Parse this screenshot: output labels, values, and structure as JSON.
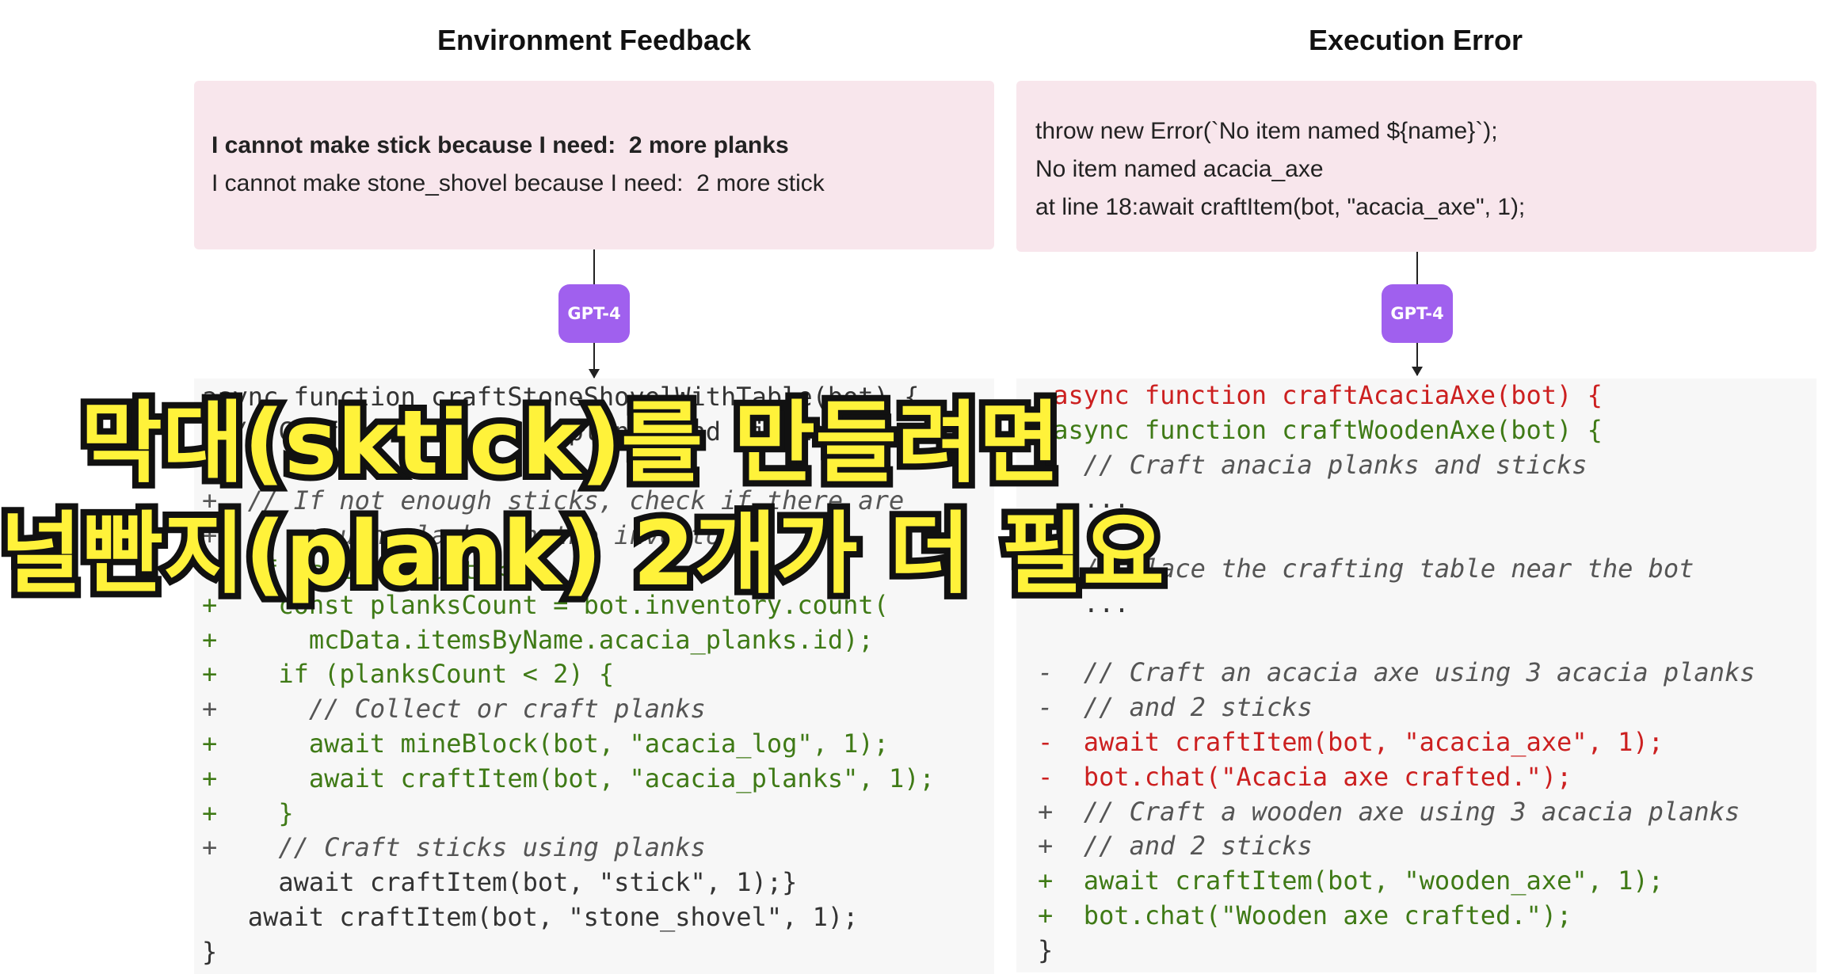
{
  "left": {
    "title": "Environment Feedback",
    "feedback_lines": [
      {
        "text": "I cannot make stick because I need:  2 more planks",
        "bold": true
      },
      {
        "text": "I cannot make stone_shovel because I need:  2 more stick",
        "bold": false
      }
    ],
    "model_badge": "GPT-4",
    "code_lines": [
      {
        "kind": "normal",
        "text": "async function craftStoneShovelWithTable(bot) {"
      },
      {
        "kind": "normal",
        "text": "  // Craft sticks using planks and minings"
      },
      {
        "kind": "normal",
        "text": "  ..."
      },
      {
        "kind": "add-comment",
        "text": "+  // If not enough sticks, check if there are"
      },
      {
        "kind": "add-comment",
        "text": "+  // enough planks in the inventory"
      },
      {
        "kind": "add",
        "text": "+  if (sticksCount < 2) {"
      },
      {
        "kind": "add",
        "text": "+    const planksCount = bot.inventory.count("
      },
      {
        "kind": "add",
        "text": "+      mcData.itemsByName.acacia_planks.id);"
      },
      {
        "kind": "add",
        "text": "+    if (planksCount < 2) {"
      },
      {
        "kind": "add-comment",
        "text": "+      // Collect or craft planks"
      },
      {
        "kind": "add",
        "text": "+      await mineBlock(bot, \"acacia_log\", 1);"
      },
      {
        "kind": "add",
        "text": "+      await craftItem(bot, \"acacia_planks\", 1);"
      },
      {
        "kind": "add",
        "text": "+    }"
      },
      {
        "kind": "add-comment",
        "text": "+    // Craft sticks using planks"
      },
      {
        "kind": "normal",
        "text": "     await craftItem(bot, \"stick\", 1);}"
      },
      {
        "kind": "normal",
        "text": "   await craftItem(bot, \"stone_shovel\", 1);"
      },
      {
        "kind": "normal",
        "text": "}"
      }
    ]
  },
  "right": {
    "title": "Execution Error",
    "error_lines": [
      "throw new Error(`No item named ${name}`);",
      "No item named acacia_axe",
      "at line 18:await craftItem(bot, \"acacia_axe\", 1);"
    ],
    "model_badge": "GPT-4",
    "code_lines": [
      {
        "kind": "del",
        "text": "-async function craftAcaciaAxe(bot) {"
      },
      {
        "kind": "add",
        "text": "+async function craftWoodenAxe(bot) {"
      },
      {
        "kind": "comment",
        "text": "   // Craft anacia planks and sticks"
      },
      {
        "kind": "normal",
        "text": "   ..."
      },
      {
        "kind": "normal",
        "text": ""
      },
      {
        "kind": "comment",
        "text": "   // Place the crafting table near the bot"
      },
      {
        "kind": "normal",
        "text": "   ..."
      },
      {
        "kind": "normal",
        "text": ""
      },
      {
        "kind": "del-comment",
        "text": "-  // Craft an acacia axe using 3 acacia planks"
      },
      {
        "kind": "del-comment",
        "text": "-  // and 2 sticks"
      },
      {
        "kind": "del",
        "text": "-  await craftItem(bot, \"acacia_axe\", 1);"
      },
      {
        "kind": "del",
        "text": "-  bot.chat(\"Acacia axe crafted.\");"
      },
      {
        "kind": "add-comment",
        "text": "+  // Craft a wooden axe using 3 acacia planks"
      },
      {
        "kind": "add-comment",
        "text": "+  // and 2 sticks"
      },
      {
        "kind": "add",
        "text": "+  await craftItem(bot, \"wooden_axe\", 1);"
      },
      {
        "kind": "add",
        "text": "+  bot.chat(\"Wooden axe crafted.\");"
      },
      {
        "kind": "normal",
        "text": "}"
      }
    ]
  },
  "caption": {
    "line1": "막대(sktick)를 만들려면",
    "line2": "널빤지(plank) 2개가 더 필요"
  }
}
